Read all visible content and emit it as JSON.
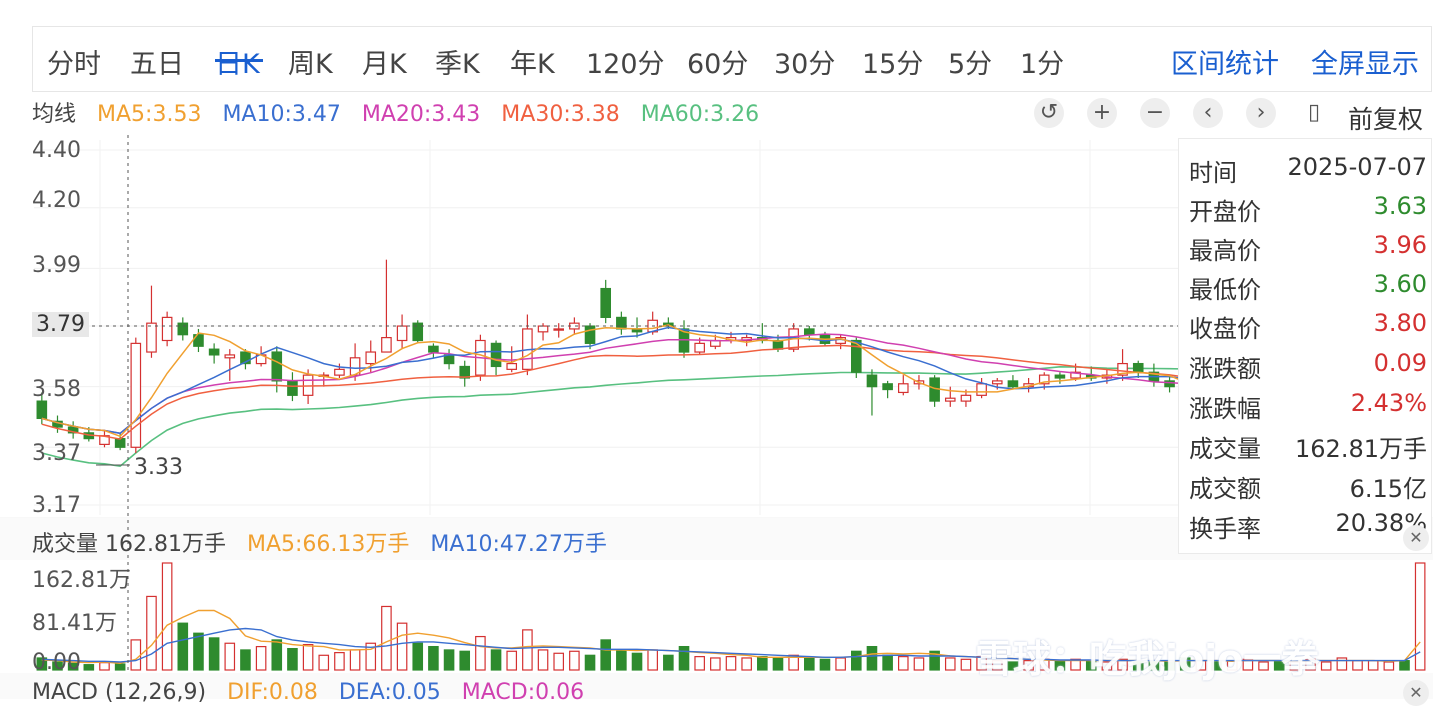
{
  "tabs": [
    "分时",
    "五日",
    "日K",
    "周K",
    "月K",
    "季K",
    "年K",
    "120分",
    "60分",
    "30分",
    "15分",
    "5分",
    "1分"
  ],
  "active_tab": "日K",
  "links": {
    "range_stats": "区间统计",
    "fullscreen": "全屏显示"
  },
  "ma": {
    "label": "均线",
    "ma5": "MA5:3.53",
    "ma10": "MA10:3.47",
    "ma20": "MA20:3.43",
    "ma30": "MA30:3.38",
    "ma60": "MA60:3.26"
  },
  "controls": {
    "fuquan": "前复权"
  },
  "price_axis": {
    "ticks": [
      "4.40",
      "4.20",
      "3.99",
      "3.79",
      "3.58",
      "3.37",
      "3.17"
    ],
    "crosshair_price": "3.79",
    "low_marker": "3.33"
  },
  "info_panel": {
    "rows": [
      {
        "k": "时间",
        "v": "2025-07-07",
        "color": "#333333"
      },
      {
        "k": "开盘价",
        "v": "3.63",
        "color": "#2e8b2e"
      },
      {
        "k": "最高价",
        "v": "3.96",
        "color": "#d43030"
      },
      {
        "k": "最低价",
        "v": "3.60",
        "color": "#2e8b2e"
      },
      {
        "k": "收盘价",
        "v": "3.80",
        "color": "#d43030"
      },
      {
        "k": "涨跌额",
        "v": "0.09",
        "color": "#d43030"
      },
      {
        "k": "涨跌幅",
        "v": "2.43%",
        "color": "#d43030"
      },
      {
        "k": "成交量",
        "v": "162.81万手",
        "color": "#333333"
      },
      {
        "k": "成交额",
        "v": "6.15亿",
        "color": "#333333"
      },
      {
        "k": "换手率",
        "v": "20.38%",
        "color": "#333333"
      }
    ]
  },
  "volume": {
    "label": "成交量 162.81万手",
    "ma5": "MA5:66.13万手",
    "ma10": "MA10:47.27万手",
    "ticks": [
      "162.81万",
      "81.41万",
      "0.00"
    ]
  },
  "macd": {
    "label": "MACD (12,26,9)",
    "dif": "DIF:0.08",
    "dea": "DEA:0.05",
    "macd": "MACD:0.06"
  },
  "watermark": "雪球：吃我jojo一拳",
  "colors": {
    "up": "#d43030",
    "down": "#2e8b2e",
    "ma5": "#f0a030",
    "ma10": "#3a6fd0",
    "ma20": "#d040b0",
    "ma30": "#f06040",
    "ma60": "#58c080",
    "accent": "#1a5fd0"
  },
  "chart_data": {
    "type": "candlestick",
    "ylim": [
      3.17,
      4.4
    ],
    "candles": [
      [
        3.53,
        3.47,
        3.56,
        3.45
      ],
      [
        3.46,
        3.44,
        3.48,
        3.42
      ],
      [
        3.44,
        3.42,
        3.46,
        3.4
      ],
      [
        3.42,
        3.4,
        3.44,
        3.39
      ],
      [
        3.38,
        3.41,
        3.43,
        3.37
      ],
      [
        3.4,
        3.37,
        3.42,
        3.36
      ],
      [
        3.37,
        3.73,
        3.75,
        3.35
      ],
      [
        3.7,
        3.8,
        3.93,
        3.68
      ],
      [
        3.74,
        3.82,
        3.84,
        3.72
      ],
      [
        3.8,
        3.76,
        3.82,
        3.74
      ],
      [
        3.76,
        3.72,
        3.78,
        3.7
      ],
      [
        3.71,
        3.69,
        3.73,
        3.66
      ],
      [
        3.68,
        3.69,
        3.71,
        3.6
      ],
      [
        3.7,
        3.66,
        3.71,
        3.64
      ],
      [
        3.66,
        3.69,
        3.72,
        3.65
      ],
      [
        3.7,
        3.6,
        3.72,
        3.56
      ],
      [
        3.6,
        3.55,
        3.63,
        3.53
      ],
      [
        3.55,
        3.62,
        3.64,
        3.52
      ],
      [
        3.62,
        3.62,
        3.63,
        3.58
      ],
      [
        3.62,
        3.64,
        3.66,
        3.61
      ],
      [
        3.62,
        3.68,
        3.73,
        3.6
      ],
      [
        3.66,
        3.7,
        3.74,
        3.63
      ],
      [
        3.7,
        3.75,
        4.02,
        3.7
      ],
      [
        3.74,
        3.79,
        3.83,
        3.71
      ],
      [
        3.8,
        3.74,
        3.81,
        3.73
      ],
      [
        3.72,
        3.7,
        3.73,
        3.68
      ],
      [
        3.69,
        3.66,
        3.71,
        3.64
      ],
      [
        3.65,
        3.61,
        3.67,
        3.58
      ],
      [
        3.62,
        3.74,
        3.76,
        3.6
      ],
      [
        3.73,
        3.65,
        3.74,
        3.62
      ],
      [
        3.64,
        3.66,
        3.72,
        3.63
      ],
      [
        3.64,
        3.78,
        3.83,
        3.62
      ],
      [
        3.77,
        3.79,
        3.8,
        3.74
      ],
      [
        3.78,
        3.78,
        3.8,
        3.75
      ],
      [
        3.78,
        3.8,
        3.82,
        3.76
      ],
      [
        3.79,
        3.73,
        3.8,
        3.71
      ],
      [
        3.92,
        3.82,
        3.95,
        3.8
      ],
      [
        3.82,
        3.78,
        3.84,
        3.76
      ],
      [
        3.78,
        3.77,
        3.82,
        3.75
      ],
      [
        3.77,
        3.81,
        3.84,
        3.76
      ],
      [
        3.8,
        3.79,
        3.82,
        3.78
      ],
      [
        3.78,
        3.7,
        3.81,
        3.68
      ],
      [
        3.7,
        3.73,
        3.75,
        3.69
      ],
      [
        3.72,
        3.74,
        3.76,
        3.71
      ],
      [
        3.74,
        3.75,
        3.77,
        3.73
      ],
      [
        3.74,
        3.75,
        3.76,
        3.72
      ],
      [
        3.75,
        3.74,
        3.8,
        3.73
      ],
      [
        3.74,
        3.71,
        3.76,
        3.7
      ],
      [
        3.71,
        3.78,
        3.8,
        3.7
      ],
      [
        3.78,
        3.76,
        3.79,
        3.74
      ],
      [
        3.76,
        3.73,
        3.77,
        3.72
      ],
      [
        3.73,
        3.75,
        3.76,
        3.71
      ],
      [
        3.74,
        3.63,
        3.75,
        3.61
      ],
      [
        3.62,
        3.58,
        3.64,
        3.48
      ],
      [
        3.59,
        3.57,
        3.6,
        3.54
      ],
      [
        3.56,
        3.59,
        3.62,
        3.55
      ],
      [
        3.59,
        3.6,
        3.62,
        3.57
      ],
      [
        3.61,
        3.53,
        3.62,
        3.51
      ],
      [
        3.53,
        3.54,
        3.58,
        3.51
      ],
      [
        3.53,
        3.55,
        3.57,
        3.51
      ],
      [
        3.55,
        3.59,
        3.61,
        3.54
      ],
      [
        3.59,
        3.6,
        3.61,
        3.57
      ],
      [
        3.6,
        3.58,
        3.62,
        3.57
      ],
      [
        3.58,
        3.59,
        3.61,
        3.56
      ],
      [
        3.59,
        3.62,
        3.63,
        3.57
      ],
      [
        3.62,
        3.61,
        3.63,
        3.59
      ],
      [
        3.61,
        3.63,
        3.66,
        3.6
      ],
      [
        3.62,
        3.61,
        3.65,
        3.6
      ],
      [
        3.61,
        3.62,
        3.64,
        3.59
      ],
      [
        3.62,
        3.66,
        3.71,
        3.6
      ],
      [
        3.66,
        3.63,
        3.67,
        3.61
      ],
      [
        3.63,
        3.6,
        3.66,
        3.58
      ],
      [
        3.6,
        3.58,
        3.62,
        3.56
      ],
      [
        3.58,
        3.51,
        3.59,
        3.49
      ],
      [
        3.51,
        3.56,
        3.58,
        3.5
      ],
      [
        3.56,
        3.54,
        3.58,
        3.53
      ],
      [
        3.54,
        3.59,
        3.61,
        3.53
      ],
      [
        3.59,
        3.61,
        3.62,
        3.57
      ],
      [
        3.61,
        3.62,
        3.64,
        3.6
      ],
      [
        3.62,
        3.6,
        3.65,
        3.59
      ],
      [
        3.6,
        3.62,
        3.63,
        3.58
      ],
      [
        3.62,
        3.67,
        3.69,
        3.61
      ],
      [
        3.67,
        3.68,
        3.7,
        3.64
      ],
      [
        3.67,
        3.72,
        3.74,
        3.66
      ],
      [
        3.72,
        3.73,
        3.75,
        3.7
      ],
      [
        3.73,
        3.75,
        3.77,
        3.72
      ],
      [
        3.75,
        3.76,
        3.78,
        3.73
      ],
      [
        3.76,
        3.74,
        3.78,
        3.72
      ],
      [
        3.63,
        3.8,
        3.96,
        3.6
      ]
    ],
    "volume": [
      18,
      12,
      10,
      8,
      11,
      9,
      45,
      110,
      160,
      70,
      55,
      48,
      40,
      30,
      35,
      45,
      32,
      38,
      22,
      26,
      30,
      40,
      95,
      70,
      40,
      35,
      30,
      28,
      50,
      30,
      28,
      60,
      30,
      25,
      28,
      22,
      45,
      30,
      25,
      30,
      22,
      35,
      20,
      18,
      20,
      18,
      20,
      18,
      22,
      18,
      16,
      18,
      28,
      35,
      22,
      20,
      18,
      28,
      18,
      16,
      20,
      14,
      12,
      14,
      16,
      14,
      16,
      14,
      12,
      16,
      14,
      12,
      12,
      18,
      14,
      12,
      14,
      16,
      12,
      14,
      12,
      16,
      12,
      18,
      14,
      14,
      12,
      14,
      160
    ],
    "ma5_vol": [
      15,
      14,
      12,
      11,
      12,
      10,
      16,
      37,
      67,
      79,
      89,
      89,
      77,
      51,
      43,
      42,
      38,
      36,
      35,
      30,
      30,
      31,
      42,
      52,
      55,
      52,
      48,
      41,
      35,
      33,
      33,
      35,
      36,
      35,
      34,
      33,
      30,
      30,
      29,
      30,
      29,
      28,
      26,
      25,
      23,
      22,
      19,
      19,
      19,
      19,
      19,
      19,
      20,
      24,
      25,
      24,
      25,
      24,
      21,
      20,
      19,
      18,
      17,
      16,
      15,
      14,
      14,
      14,
      14,
      14,
      14,
      14,
      13,
      14,
      14,
      14,
      13,
      14,
      14,
      14,
      13,
      14,
      14,
      14,
      14,
      14,
      13,
      14,
      42
    ],
    "ma10_vol": [
      16,
      15,
      14,
      13,
      13,
      12,
      14,
      24,
      40,
      45,
      50,
      55,
      60,
      62,
      60,
      50,
      45,
      42,
      40,
      38,
      35,
      34,
      36,
      40,
      42,
      42,
      40,
      38,
      36,
      34,
      32,
      33,
      34,
      34,
      33,
      32,
      31,
      31,
      31,
      30,
      29,
      28,
      27,
      26,
      25,
      24,
      23,
      22,
      21,
      20,
      19,
      19,
      20,
      21,
      22,
      22,
      21,
      21,
      21,
      20,
      19,
      18,
      17,
      16,
      16,
      15,
      15,
      15,
      14,
      14,
      14,
      14,
      14,
      14,
      14,
      14,
      14,
      14,
      14,
      14,
      14,
      14,
      14,
      14,
      14,
      14,
      14,
      14,
      27
    ]
  }
}
